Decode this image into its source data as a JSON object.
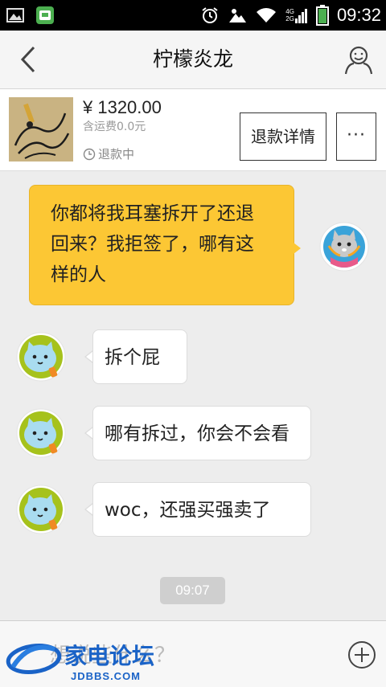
{
  "status_bar": {
    "time": "09:32",
    "network_top": "4G",
    "network_bottom": "2G",
    "icons": [
      "gallery-icon",
      "app-icon",
      "alarm-icon",
      "weather-icon",
      "wifi-icon",
      "signal-icon",
      "battery-icon"
    ]
  },
  "header": {
    "title": "柠檬炎龙",
    "icons": [
      "back-chevron-icon",
      "user-profile-icon"
    ]
  },
  "product": {
    "price": "¥ 1320.00",
    "shipping": "含运费0.0元",
    "status": "退款中",
    "refund_button": "退款详情",
    "more_button": "···"
  },
  "messages": [
    {
      "from": "me",
      "text_lines": [
        "你都将我耳塞拆开了还退",
        "回来？我拒签了，哪有这",
        "样的人"
      ]
    },
    {
      "from": "other",
      "text": "拆个屁"
    },
    {
      "from": "other",
      "text": "哪有拆过，你会不会看"
    },
    {
      "from": "other",
      "text": "woc，还强买强卖了"
    }
  ],
  "timestamp": "09:07",
  "input": {
    "placeholder_visible": "想说些什么？",
    "add_icon": "plus-circle-icon"
  },
  "watermark": {
    "text": "家电论坛",
    "url": "JDBBS.COM"
  },
  "colors": {
    "my_bubble": "#fcc734",
    "their_bubble": "#ffffff",
    "background": "#ededed",
    "watermark_blue": "#1a63c7"
  }
}
